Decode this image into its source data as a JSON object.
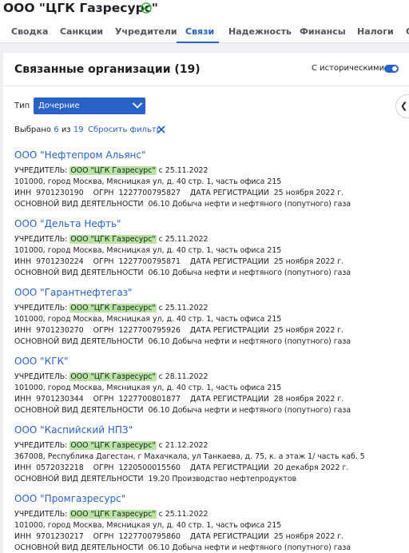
{
  "company": {
    "title": "ООО \"ЦГК Газресурс\"",
    "verified_icon": "check-circle-icon"
  },
  "tabs": [
    {
      "label": "Сводка"
    },
    {
      "label": "Санкции"
    },
    {
      "label": "Учредители"
    },
    {
      "label": "Связи",
      "active": true
    },
    {
      "label": "Надежность"
    },
    {
      "label": "Финансы"
    },
    {
      "label": "Налоги"
    },
    {
      "label": "С"
    }
  ],
  "panel": {
    "title": "Связанные организации (19)",
    "historical_label": "С историческими",
    "historical_on": true
  },
  "filter": {
    "type_label": "Тип",
    "type_value": "Дочерние",
    "selected_prefix": "Выбрано",
    "selected_count": "6",
    "selected_of": "из",
    "selected_total": "19",
    "reset_label": "Сбросить фильтр"
  },
  "labels": {
    "founder": "УЧРЕДИТЕЛЬ:",
    "inn": "ИНН",
    "ogrn": "ОГРН",
    "reg_date": "ДАТА РЕГИСТРАЦИИ",
    "activity": "ОСНОВНОЙ ВИД ДЕЯТЕЛЬНОСТИ"
  },
  "organizations": [
    {
      "name": "ООО \"Нефтепром Альянс\"",
      "founder": "ООО \"ЦГК Газресурс\"",
      "founder_since": "с 25.11.2022",
      "address": "101000, город Москва, Мясницкая ул, д. 40 стр. 1, часть офиса 215",
      "inn": "9701230190",
      "ogrn": "1227700795827",
      "reg_date": "25 ноября 2022 г.",
      "activity": "06.10 Добыча нефти и нефтяного (попутного) газа"
    },
    {
      "name": "ООО \"Дельта Нефть\"",
      "founder": "ООО \"ЦГК Газресурс\"",
      "founder_since": "с 25.11.2022",
      "address": "101000, город Москва, Мясницкая ул, д. 40 стр. 1, часть офиса 215",
      "inn": "9701230224",
      "ogrn": "1227700795871",
      "reg_date": "25 ноября 2022 г.",
      "activity": "06.10 Добыча нефти и нефтяного (попутного) газа"
    },
    {
      "name": "ООО \"Гарантнефтегаз\"",
      "founder": "ООО \"ЦГК Газресурс\"",
      "founder_since": "с 25.11.2022",
      "address": "101000, город Москва, Мясницкая ул, д. 40 стр. 1, часть офиса 215",
      "inn": "9701230270",
      "ogrn": "1227700795926",
      "reg_date": "25 ноября 2022 г.",
      "activity": "06.10 Добыча нефти и нефтяного (попутного) газа"
    },
    {
      "name": "ООО \"КГК\"",
      "founder": "ООО \"ЦГК Газресурс\"",
      "founder_since": "с 28.11.2022",
      "address": "101000, город Москва, Мясницкая ул, д. 40 стр. 1, часть офиса 215",
      "inn": "9701230344",
      "ogrn": "1227700801877",
      "reg_date": "28 ноября 2022 г.",
      "activity": "06.10 Добыча нефти и нефтяного (попутного) газа"
    },
    {
      "name": "ООО \"Каспийский НПЗ\"",
      "founder": "ООО \"ЦГК Газресурс\"",
      "founder_since": "с 21.12.2022",
      "address": "367008, Республика Дагестан, г Махачкала, ул Танкаева, д. 75, к. а этаж 1/ часть каб. 5",
      "inn": "0572032218",
      "ogrn": "1220500015560",
      "reg_date": "20 декабря 2022 г.",
      "activity": "19.20 Производство нефтепродуктов"
    },
    {
      "name": "ООО \"Промгазресурс\"",
      "founder": "ООО \"ЦГК Газресурс\"",
      "founder_since": "с 25.11.2022",
      "address": "101000, город Москва, Мясницкая ул, д. 40 стр. 1, часть офиса 215",
      "inn": "9701230217",
      "ogrn": "1227700795860",
      "reg_date": "25 ноября 2022 г.",
      "activity": "06.10 Добыча нефти и нефтяного (попутного) газа"
    }
  ],
  "colors": {
    "accent": "#2862c8",
    "highlight": "#b9e3a2",
    "verified": "#3cb23c"
  }
}
